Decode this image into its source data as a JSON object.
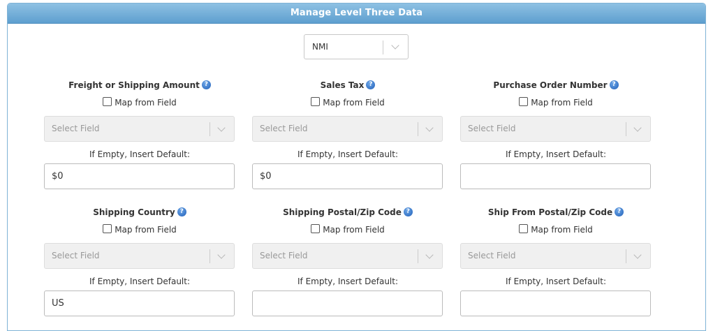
{
  "panel": {
    "title": "Manage Level Three Data"
  },
  "processor": {
    "selected": "NMI"
  },
  "common": {
    "map_label": "Map from Field",
    "select_placeholder": "Select Field",
    "default_label": "If Empty, Insert Default:",
    "help_glyph": "?"
  },
  "fields": [
    {
      "title": "Freight or Shipping Amount",
      "default_value": "$0"
    },
    {
      "title": "Sales Tax",
      "default_value": "$0"
    },
    {
      "title": "Purchase Order Number",
      "default_value": ""
    },
    {
      "title": "Shipping Country",
      "default_value": "US"
    },
    {
      "title": "Shipping Postal/Zip Code",
      "default_value": ""
    },
    {
      "title": "Ship From Postal/Zip Code",
      "default_value": ""
    }
  ],
  "colors": {
    "header_gradient_top": "#8ec1e3",
    "header_gradient_bottom": "#5e9fcf",
    "panel_border": "#7fb3d6",
    "help_icon": "#1e5eb8",
    "disabled_select_bg": "#f0f0f0"
  },
  "icons": {
    "help": "help-question-icon",
    "dropdown": "chevron-down-icon",
    "checkbox": "checkbox-unchecked-icon"
  }
}
